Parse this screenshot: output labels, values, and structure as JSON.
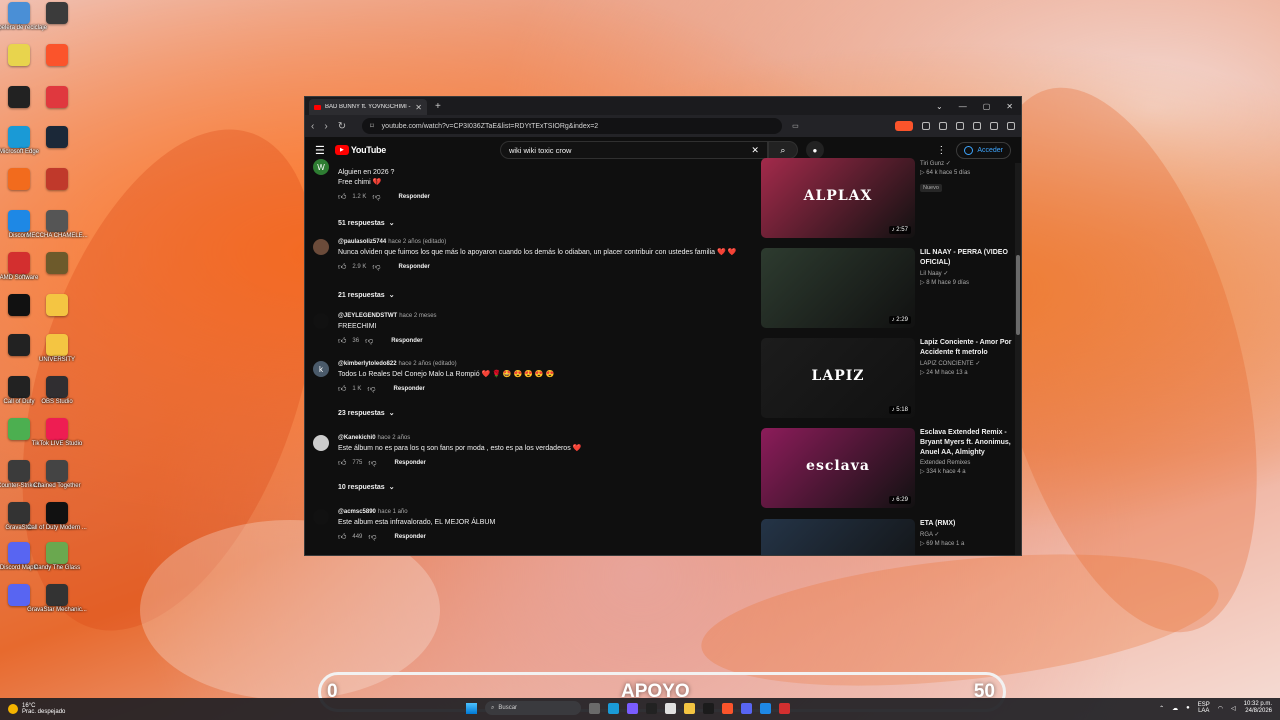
{
  "desktop": {
    "icons": [
      {
        "label": "Papelera de reciclaje",
        "color": "#4a8fd6"
      },
      {
        "label": "",
        "color": "#3b3b3b"
      },
      {
        "label": "",
        "color": "#e8d44d"
      },
      {
        "label": "",
        "color": "#fb542b"
      },
      {
        "label": "",
        "color": "#222222"
      },
      {
        "label": "",
        "color": "#e0383e"
      },
      {
        "label": "Microsoft Edge",
        "color": "#1a9ad6"
      },
      {
        "label": "",
        "color": "#1b2838"
      },
      {
        "label": "",
        "color": "#f26b1d"
      },
      {
        "label": "",
        "color": "#c0392b"
      },
      {
        "label": "Discord",
        "color": "#1e88e5"
      },
      {
        "label": "MECCHA CHAMELE...",
        "color": "#555555"
      },
      {
        "label": "AMD Software",
        "color": "#d32f2f"
      },
      {
        "label": "",
        "color": "#6d5a2b"
      },
      {
        "label": "",
        "color": "#111111"
      },
      {
        "label": "",
        "color": "#f4c542"
      },
      {
        "label": "",
        "color": "#222222"
      },
      {
        "label": "UNIVERSITY",
        "color": "#f4c542"
      },
      {
        "label": "Call of Duty",
        "color": "#222222"
      },
      {
        "label": "OBS Studio",
        "color": "#302e31"
      },
      {
        "label": "",
        "color": "#4caf50"
      },
      {
        "label": "TikTok LIVE Studio",
        "color": "#ee1d52"
      },
      {
        "label": "Counter-Strike 2",
        "color": "#3b3b3b"
      },
      {
        "label": "Chained Together",
        "color": "#444444"
      },
      {
        "label": "GravaStar",
        "color": "#333333"
      },
      {
        "label": "Call of Duty Modern ...",
        "color": "#111111"
      },
      {
        "label": "Discord Maple",
        "color": "#5865f2"
      },
      {
        "label": "Candy The Glass",
        "color": "#6aa84f"
      },
      {
        "label": "",
        "color": "#5865f2"
      },
      {
        "label": "GravaStar Mechanic...",
        "color": "#333333"
      }
    ]
  },
  "browser": {
    "tab_title": "BAD BUNNY ft. YOVNGCHIMI - ...",
    "url": "youtube.com/watch?v=CP3I036ZTaE&list=RDYtTExTSIORg&index=2"
  },
  "youtube": {
    "brand": "YouTube",
    "search_query": "wiki wiki toxic crow",
    "sign_in": "Acceder",
    "comments": [
      {
        "author": "",
        "time": "",
        "text": "Alguien en 2026 ?\nFree chimi 💔",
        "likes": "1.2 K",
        "reply": "Responder",
        "avatar_letter": "W",
        "avatar_color": "#2e7d32",
        "replies": "51 respuestas"
      },
      {
        "author": "@paulasoliz5744",
        "time": "hace 2 años (editado)",
        "text": "Nunca olviden que fuimos los que más lo apoyaron cuando los demás lo odiaban, un placer contribuir con ustedes familia ❤️ ❤️",
        "likes": "2.9 K",
        "reply": "Responder",
        "avatar_letter": "",
        "avatar_color": "#6b4b3a",
        "replies": "21 respuestas"
      },
      {
        "author": "@JEYLEGENDSTWT",
        "time": "hace 2 meses",
        "text": "FREECHIMI",
        "likes": "36",
        "reply": "Responder",
        "avatar_letter": "",
        "avatar_color": "#111111",
        "replies": ""
      },
      {
        "author": "@kimberlytoledo822",
        "time": "hace 2 años (editado)",
        "text": "Todos Lo Reales Del Conejo Malo La Rompió ❤️ 🌹 🤩 😍 😍 😍 😍",
        "likes": "1 K",
        "reply": "Responder",
        "avatar_letter": "k",
        "avatar_color": "#4a5a6a",
        "replies": "23 respuestas"
      },
      {
        "author": "@Kanekichi0",
        "time": "hace 2 años",
        "text": "Este álbum no es para los q son fans por moda , esto es pa los verdaderos ❤️",
        "likes": "775",
        "reply": "Responder",
        "avatar_letter": "",
        "avatar_color": "#cccccc",
        "replies": "10 respuestas"
      },
      {
        "author": "@acmsc5890",
        "time": "hace 1 año",
        "text": "Este album esta infravalorado, EL MEJOR ÁLBUM",
        "likes": "449",
        "reply": "Responder",
        "avatar_letter": "",
        "avatar_color": "#111111",
        "replies": ""
      }
    ],
    "related": [
      {
        "title": "",
        "channel": "Tiri Gunz ✓",
        "meta": "▷ 64 k   hace 5 días",
        "badge": "Nuevo",
        "duration": "♪ 2:57",
        "thumb_color": "#a32a4b",
        "thumb_text": "ALPLAX"
      },
      {
        "title": "LIL NAAY - PERRA (VIDEO OFICIAL)",
        "channel": "Lil Naay ✓",
        "meta": "▷ 8 M   hace 9 días",
        "badge": "",
        "duration": "♪ 2:29",
        "thumb_color": "#2d3b2f",
        "thumb_text": ""
      },
      {
        "title": "Lapiz Conciente - Amor Por Accidente ft metrolo",
        "channel": "LAPIZ CONCIENTE ✓",
        "meta": "▷ 24 M   hace 13 a",
        "badge": "",
        "duration": "♪ 5:18",
        "thumb_color": "#1c1c1c",
        "thumb_text": "LAPIZ"
      },
      {
        "title": "Esclava Extended Remix - Bryant Myers ft. Anonimus, Anuel AA, Almighty",
        "channel": "Extended Remixes",
        "meta": "▷ 334 k   hace 4 a",
        "badge": "",
        "duration": "♪ 6:29",
        "thumb_color": "#8c1c5a",
        "thumb_text": "esclava"
      },
      {
        "title": "ETA (RMX)",
        "channel": "RGA ✓",
        "meta": "▷ 69 M   hace 1 a",
        "badge": "",
        "duration": "",
        "thumb_color": "#243447",
        "thumb_text": ""
      }
    ]
  },
  "overlay": {
    "min": "0",
    "title": "APOYO",
    "max": "50"
  },
  "taskbar": {
    "temp": "16°C",
    "weather": "Prac. despejado",
    "search": "Buscar",
    "lang": "ESP",
    "lang2": "LAA",
    "time": "10:32 p.m.",
    "date": "24/8/2026"
  }
}
